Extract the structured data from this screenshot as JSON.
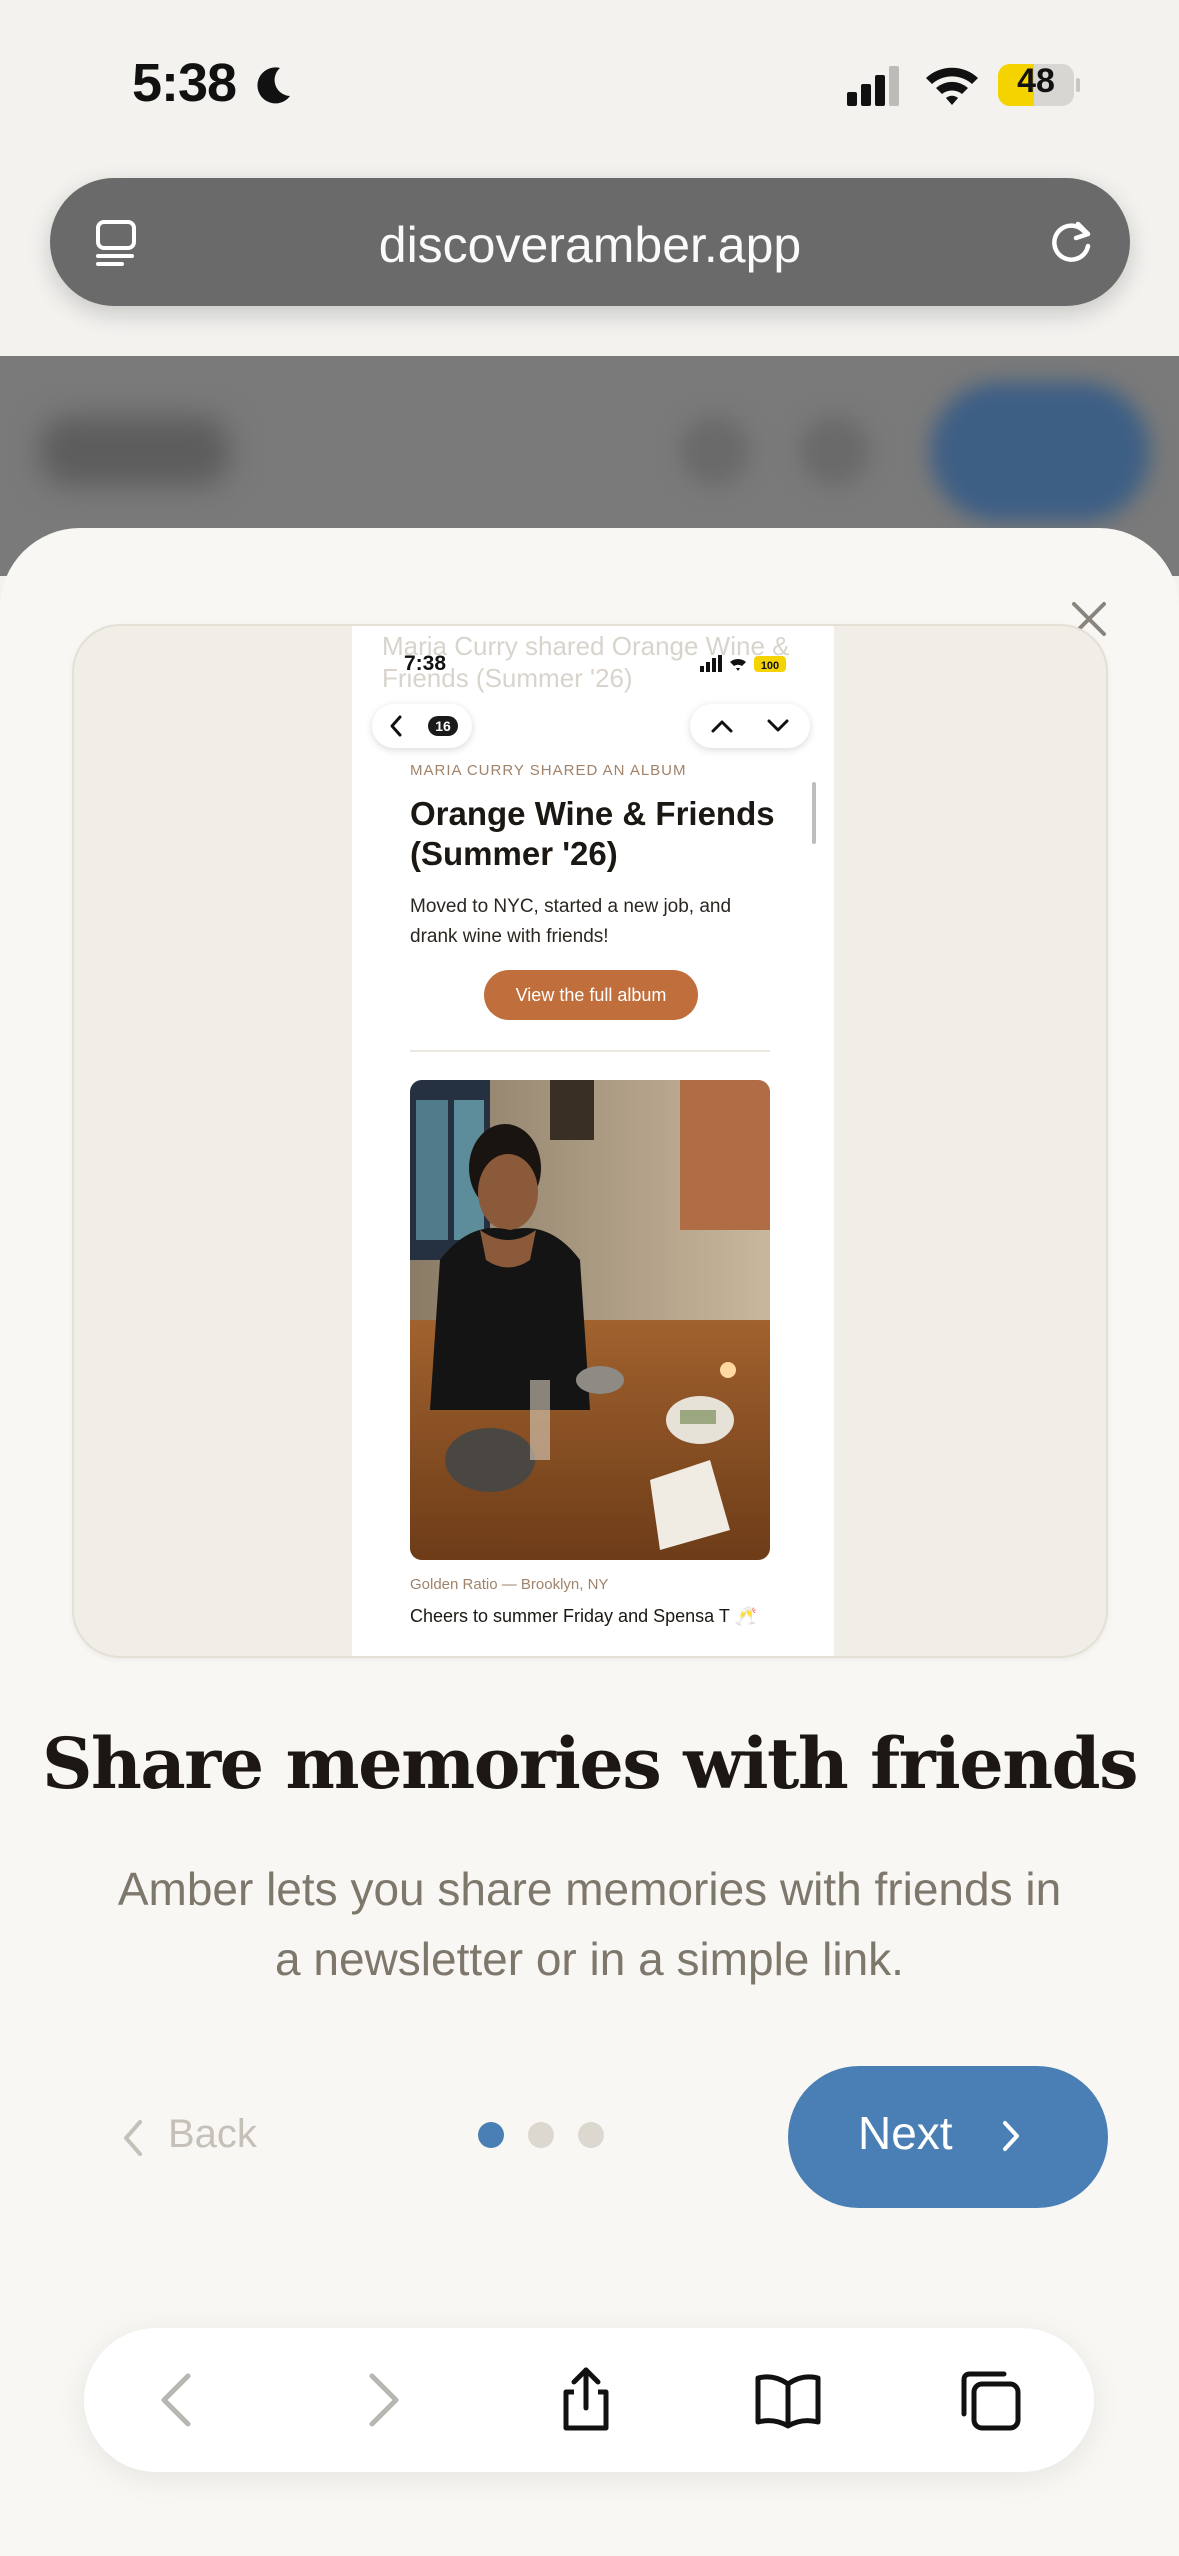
{
  "status_bar": {
    "time": "5:38",
    "battery_percent": "48",
    "battery_level": 0.48
  },
  "browser": {
    "url": "discoveramber.app"
  },
  "preview": {
    "ghost_text": "Maria Curry shared Orange Wine & Friends (Summer '26)",
    "phone_time": "7:38",
    "phone_battery": "100",
    "back_badge": "16",
    "eyebrow": "Maria Curry shared an album",
    "album_title": "Orange Wine & Friends (Summer '26)",
    "album_description": "Moved to NYC, started a new job, and drank wine with friends!",
    "view_button": "View the full album",
    "caption_location": "Golden Ratio — Brooklyn, NY",
    "caption": "Cheers to summer Friday and Spensa T 🥂"
  },
  "onboarding": {
    "title": "Share memories with friends",
    "subtitle": "Amber lets you share memories with friends in a newsletter or in a simple link.",
    "back_label": "Back",
    "next_label": "Next",
    "page_count": 3,
    "current_page": 1
  },
  "colors": {
    "accent": "#4a7fb5",
    "album_button": "#c06e3c",
    "battery_fill": "#f5d300"
  }
}
